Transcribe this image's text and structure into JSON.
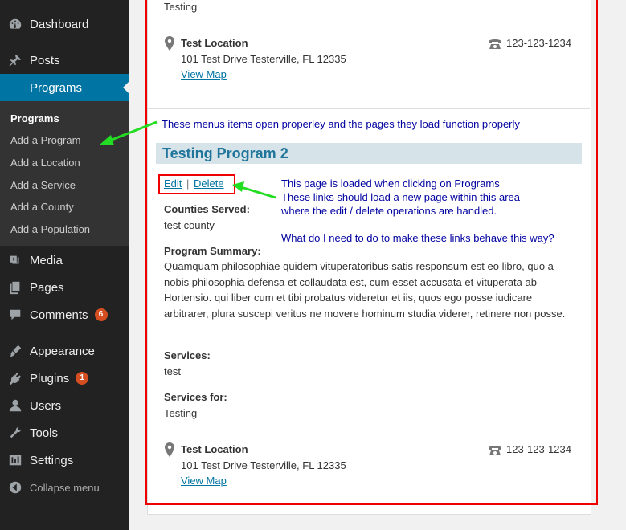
{
  "sidebar": {
    "items": [
      {
        "label": "Dashboard",
        "icon": "dashboard-icon"
      },
      {
        "label": "Posts",
        "icon": "pin-icon"
      },
      {
        "label": "Programs",
        "icon": "none"
      },
      {
        "label": "Media",
        "icon": "media-icon"
      },
      {
        "label": "Pages",
        "icon": "pages-icon"
      },
      {
        "label": "Comments",
        "icon": "comments-icon",
        "badge": "6"
      },
      {
        "label": "Appearance",
        "icon": "appearance-icon"
      },
      {
        "label": "Plugins",
        "icon": "plugins-icon",
        "badge": "1"
      },
      {
        "label": "Users",
        "icon": "users-icon"
      },
      {
        "label": "Tools",
        "icon": "tools-icon"
      },
      {
        "label": "Settings",
        "icon": "settings-icon"
      }
    ],
    "submenu": [
      "Programs",
      "Add a Program",
      "Add a Location",
      "Add a Service",
      "Add a County",
      "Add a Population"
    ],
    "collapse": "Collapse menu"
  },
  "top_entry": {
    "services_for_value": "Testing",
    "location_name": "Test Location",
    "address": "101 Test Drive Testerville, FL 12335",
    "view_map": "View Map",
    "phone": "123-123-1234"
  },
  "program": {
    "title": "Testing Program 2",
    "edit": "Edit",
    "separator": "|",
    "delete": "Delete",
    "counties_label": "Counties Served:",
    "counties_value": "test county",
    "summary_label": "Program Summary:",
    "summary": "Quamquam philosophiae quidem vituperatoribus satis responsum est eo libro, quo a nobis philosophia defensa et collaudata est, cum esset accusata et vituperata ab Hortensio. qui liber cum et tibi probatus videretur et iis, quos ego posse iudicare arbitrarer, plura suscepi veritus ne movere hominum studia viderer, retinere non posse.",
    "services_label": "Services:",
    "services_value": "test",
    "services_for_label": "Services for:",
    "services_for_value": "Testing",
    "location_name": "Test Location",
    "address": "101 Test Drive Testerville, FL 12335",
    "view_map": "View Map",
    "phone": "123-123-1234"
  },
  "annotations": {
    "menus_note": "These menus items open properley and the pages they load function properly",
    "page_note_1": "This page is loaded when clicking on Programs",
    "page_note_2": "These links should load a new page within this area",
    "page_note_3": "where the edit / delete operations are handled.",
    "question": "What do I need to do to make these links behave this way?"
  },
  "colors": {
    "sidebar_bg": "#222222",
    "active_bg": "#0074a2",
    "link": "#0074a2",
    "annotation_red": "#ee0000",
    "annotation_blue": "#0000a0",
    "arrow_green": "#22dd22"
  }
}
